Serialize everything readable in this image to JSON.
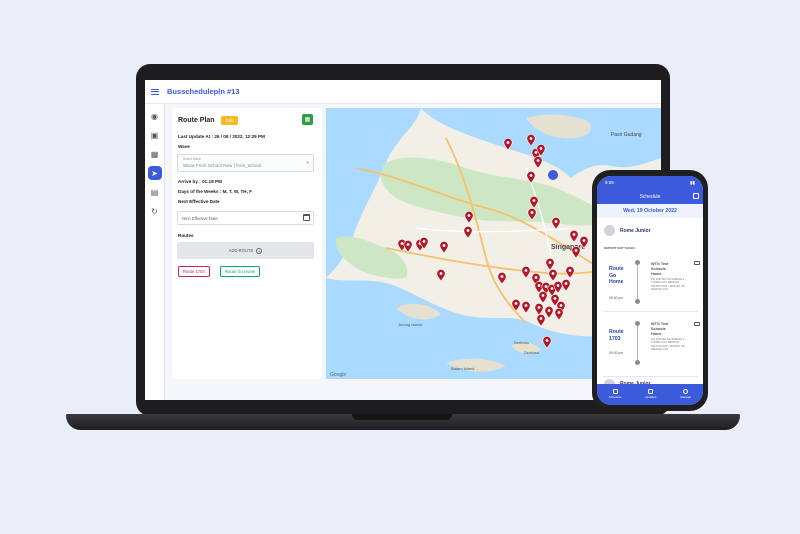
{
  "app": {
    "title": "Busschedulepln #13"
  },
  "rail": {
    "items": [
      "dashboard-icon",
      "bus-icon",
      "grid-icon",
      "compass-icon",
      "chat-icon",
      "refresh-icon"
    ],
    "active_index": 3
  },
  "panel": {
    "title": "Route Plan",
    "edit_badge": "Edit",
    "last_update": "Last Update At : 26 / 08 / 2022, 12:29 PM",
    "wave_label": "Wave",
    "select_label": "Select Wave",
    "select_value": "Wave From School New | from_school",
    "arrive_by": "Arrive by : 01:18 PM",
    "days_of_week": "Days of the Weeks : M, T, W, TH, F",
    "next_effective_label": "Next Effective Date",
    "next_effective_placeholder": "Next Effective Date",
    "routes_label": "Routes",
    "add_route": "ADD ROUTE",
    "route_chips": [
      "Route 1703",
      "Route Go Home"
    ]
  },
  "map": {
    "labels": [
      "Singapore",
      "Pasir Gudang",
      "Google",
      "Jurong Island",
      "Batam Island",
      "Sentosa",
      "Sentosa"
    ],
    "marker_color": "#b0182a"
  },
  "phone": {
    "status_time": "9:59",
    "header": "Schedule",
    "date": "Wed, 19 October 2022",
    "student": "Rome Junior",
    "section": "DEPORT NOT TAKEN",
    "cards": [
      {
        "route": [
          "Route",
          "Go",
          "Home"
        ],
        "time": "09:30 pm",
        "school": [
          "WTG Test",
          "Schools",
          "Home"
        ],
        "address": "101 AND MO NO AVENUE 3, THOMG CHU MEDICAL INSTITUTION / 4949 MO NO AVENUE 3 SG"
      },
      {
        "route": [
          "Route",
          "1703"
        ],
        "time": "09:30 pm",
        "school": [
          "WTG Test",
          "Schools",
          "Home"
        ],
        "address": "101 AND MO NO AVENUE 3, THOMG CHU MEDICAL INSTITUTION / 4949 MO NO AVENUE 3 SG"
      }
    ],
    "next_student": "Rome Junior",
    "tabs": [
      "Schedule",
      "Updates",
      "Manage"
    ]
  }
}
